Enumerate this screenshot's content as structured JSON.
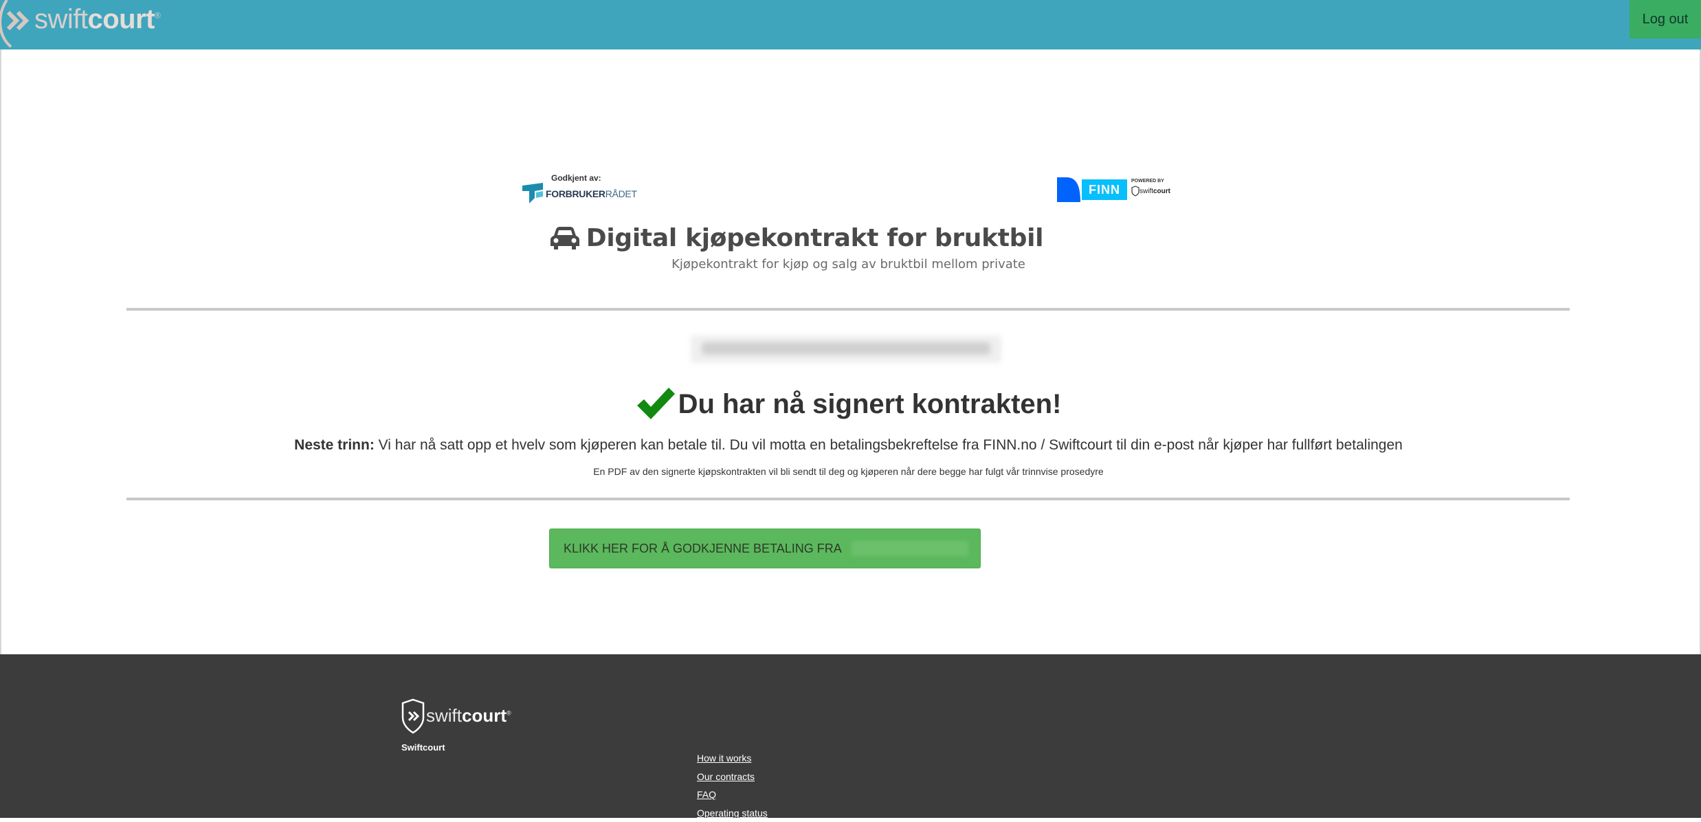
{
  "header": {
    "brand_light": "swift",
    "brand_bold": "court",
    "brand_mark": "®",
    "logout_label": "Log out"
  },
  "logos": {
    "forbruker_approved": "Godkjent av:",
    "forbruker_name_bold": "FORBRUKER",
    "forbruker_name_light": "RÅDET",
    "finn_label": "FINN",
    "powered_by": "POWERED BY",
    "powered_brand_light": "swift",
    "powered_brand_bold": "court"
  },
  "main": {
    "title": "Digital kjøpekontrakt for bruktbil",
    "subtitle": "Kjøpekontrakt for kjøp og salg av bruktbil mellom private",
    "success_title": "Du har nå signert kontrakten!",
    "next_step_label": "Neste trinn:",
    "next_step_text": " Vi har nå satt opp et hvelv som kjøperen kan betale til. Du vil motta en betalingsbekreftelse fra FINN.no / Swiftcourt til din e-post når kjøper har fullført betalingen",
    "pdf_note": "En PDF av den signerte kjøpskontrakten vil bli sendt til deg og kjøperen når dere begge har fulgt vår trinnvise prosedyre",
    "approve_button_label": "KLIKK HER FOR Å GODKJENNE BETALING FRA"
  },
  "footer": {
    "brand_light": "swift",
    "brand_bold": "court",
    "brand_mark": "®",
    "company_name": "Swiftcourt",
    "links": [
      "How it works",
      "Our contracts",
      "FAQ",
      "Operating status"
    ]
  },
  "colors": {
    "header_bg": "#3ea5bd",
    "logout_bg": "#3aad62",
    "button_green": "#5cb85c",
    "check_green": "#128a12",
    "footer_bg": "#3c3c3c"
  }
}
